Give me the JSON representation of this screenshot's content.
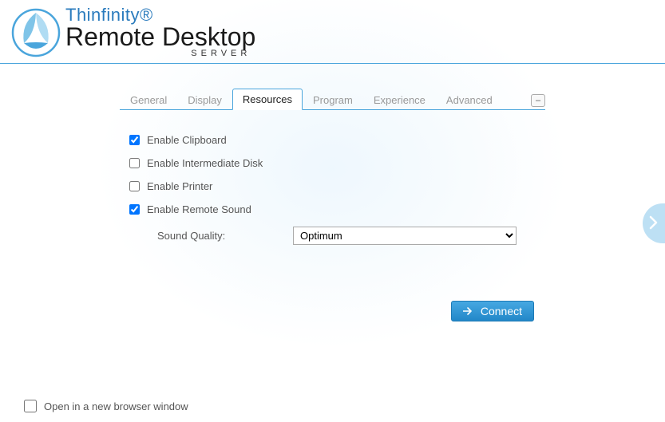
{
  "logo": {
    "top": "Thinfinity®",
    "main": "Remote Desktop",
    "sub": "SERVER"
  },
  "tabs": [
    {
      "label": "General",
      "active": false
    },
    {
      "label": "Display",
      "active": false
    },
    {
      "label": "Resources",
      "active": true
    },
    {
      "label": "Program",
      "active": false
    },
    {
      "label": "Experience",
      "active": false
    },
    {
      "label": "Advanced",
      "active": false
    }
  ],
  "collapse_symbol": "–",
  "options": {
    "clipboard": {
      "label": "Enable Clipboard",
      "checked": true
    },
    "disk": {
      "label": "Enable Intermediate Disk",
      "checked": false
    },
    "printer": {
      "label": "Enable Printer",
      "checked": false
    },
    "sound": {
      "label": "Enable Remote Sound",
      "checked": true
    },
    "sound_quality_label": "Sound Quality:",
    "sound_quality_value": "Optimum"
  },
  "connect_label": "Connect",
  "footer": {
    "new_window_label": "Open in a new browser window",
    "new_window_checked": false
  }
}
